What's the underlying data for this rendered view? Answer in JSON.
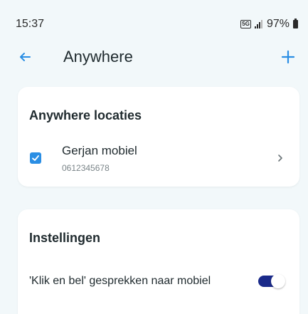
{
  "status_bar": {
    "time": "15:37",
    "network_badge": "5G",
    "battery_percent": "97%"
  },
  "app_bar": {
    "title": "Anywhere",
    "back_icon": "arrow-left-icon",
    "add_icon": "plus-icon"
  },
  "locations_card": {
    "title": "Anywhere locaties",
    "items": [
      {
        "name": "Gerjan mobiel",
        "number": "0612345678",
        "checked": true
      }
    ]
  },
  "settings_card": {
    "title": "Instellingen",
    "items": [
      {
        "label": "'Klik en bel' gesprekken naar mobiel",
        "enabled": true
      }
    ]
  },
  "colors": {
    "accent": "#2a8ee4",
    "toggle_track": "#1a2a8a",
    "background": "#f2f8fa"
  }
}
